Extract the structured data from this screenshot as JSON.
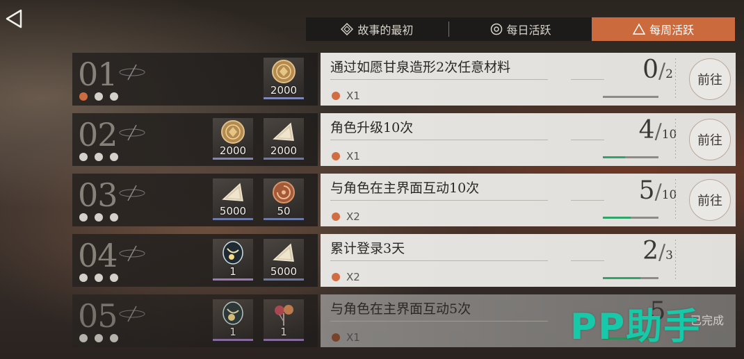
{
  "tabs": [
    {
      "label": "故事的最初",
      "icon": "diamond-icon"
    },
    {
      "label": "每日活跃",
      "icon": "circle-target-icon"
    },
    {
      "label": "每周活跃",
      "icon": "triangle-icon",
      "active": true
    }
  ],
  "tasks": [
    {
      "num": "01",
      "dots_done": 1,
      "rewards": [
        {
          "icon": "gold-coin-icon",
          "count": "2000"
        }
      ],
      "title": "通过如愿甘泉造形2次任意材料",
      "multiplier": "X1",
      "progress": "0",
      "total": "2",
      "fill": 0.0,
      "action": "前往"
    },
    {
      "num": "02",
      "dots_done": 0,
      "rewards": [
        {
          "icon": "gold-coin-icon",
          "count": "2000"
        },
        {
          "icon": "crystal-shard-icon",
          "count": "2000"
        }
      ],
      "title": "角色升级10次",
      "multiplier": "X1",
      "progress": "4",
      "total": "10",
      "fill": 0.4,
      "action": "前往"
    },
    {
      "num": "03",
      "dots_done": 0,
      "rewards": [
        {
          "icon": "crystal-shard-icon",
          "count": "5000"
        },
        {
          "icon": "ammonite-icon",
          "count": "50"
        }
      ],
      "title": "与角色在主界面互动10次",
      "multiplier": "X2",
      "progress": "5",
      "total": "10",
      "fill": 0.5,
      "action": "前往"
    },
    {
      "num": "04",
      "dots_done": 0,
      "rewards": [
        {
          "icon": "spirit-orb-icon",
          "count": "1"
        },
        {
          "icon": "crystal-shard-icon",
          "count": "5000"
        }
      ],
      "title": "累计登录3天",
      "multiplier": "X2",
      "progress": "2",
      "total": "3",
      "fill": 0.67,
      "action": ""
    },
    {
      "num": "05",
      "dots_done": 0,
      "rewards": [
        {
          "icon": "spirit-orb-icon",
          "count": "1"
        },
        {
          "icon": "flower-charm-icon",
          "count": "1"
        }
      ],
      "title": "与角色在主界面互动5次",
      "multiplier": "X1",
      "progress": "5",
      "total": "",
      "fill": 1.0,
      "action": "",
      "status": "已完成"
    }
  ],
  "watermark": "PP助手",
  "colors": {
    "accent": "#cb6a3d",
    "progress": "#2fa56a",
    "watermark": "#16c9a8"
  }
}
